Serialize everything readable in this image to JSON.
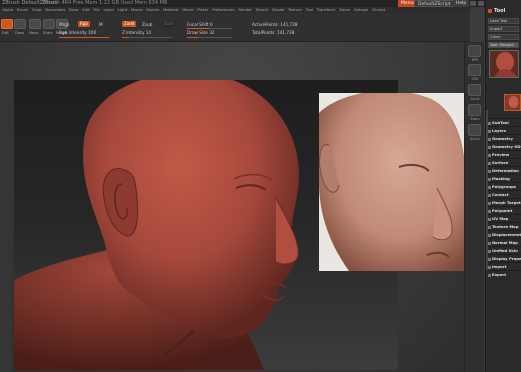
{
  "titlebar": {
    "app_title": "ZBrush DefaultZBrush",
    "path": "ZBrush 4R4 Free Mem 1.22 GB Used Mem 634 MB",
    "menus_label": "Menus",
    "script_label": "DefaultZScript",
    "help_label": "Help"
  },
  "menubar": {
    "items": [
      "Alpha",
      "Brush",
      "Color",
      "Document",
      "Draw",
      "Edit",
      "File",
      "Layer",
      "Light",
      "Macro",
      "Marker",
      "Material",
      "Movie",
      "Picker",
      "Preferences",
      "Render",
      "Stencil",
      "Stroke",
      "Texture",
      "Tool",
      "Transform",
      "Zoom",
      "Zplugin",
      "Zscript"
    ]
  },
  "shelf": {
    "tools": [
      "Edit",
      "Draw",
      "Move",
      "Scale",
      "Rotate"
    ],
    "mrgb": "Mrgb",
    "rgb": "Rgb",
    "m": "M",
    "zadd": "Zadd",
    "zsub": "Zsub",
    "zcut": "Zcut",
    "rgb_intensity": "Rgb Intensity 100",
    "z_intensity": "Z Intensity 14",
    "focal_shift": "Focal Shift 0",
    "draw_size": "Draw Size 32",
    "active_points": "ActivePoints: 141,728",
    "total_points": "TotalPoints: 141,728",
    "rgb_intensity_level": 1.0,
    "z_intensity_level": 0.14,
    "focal_shift_level": 0.5,
    "draw_size_level": 0.25
  },
  "rshelf": {
    "buttons": [
      "BPR",
      "SPix",
      "Scroll",
      "Zoom",
      "Actual"
    ]
  },
  "tray": {
    "header": "Tool",
    "buttons": [
      "Load Tool",
      "Import",
      "Clone",
      "Lightbox"
    ],
    "tool_name": "Tool: Merged",
    "subpalettes": [
      "SubTool",
      "Layers",
      "Geometry",
      "Geometry HD",
      "Preview",
      "Surface",
      "Deformation",
      "Masking",
      "Polygroups",
      "Contact",
      "Morph Target",
      "Polypaint",
      "UV Map",
      "Texture Map",
      "Displacement",
      "Normal Map",
      "Unified Skin",
      "Display Properties",
      "Import",
      "Export"
    ]
  },
  "colors": {
    "accent": "#d0561e",
    "skin_clay": "#a5483b",
    "skin_ref": "#c89885"
  }
}
